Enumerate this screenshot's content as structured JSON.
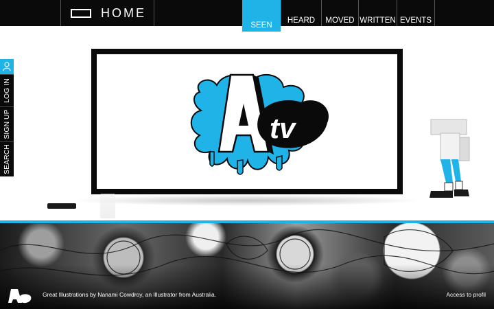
{
  "header": {
    "home_label": "HOME",
    "nav": [
      {
        "label": "SEEN",
        "active": true
      },
      {
        "label": "HEARD",
        "active": false
      },
      {
        "label": "MOVED",
        "active": false
      },
      {
        "label": "WRITTEN",
        "active": false
      },
      {
        "label": "EVENTS",
        "active": false
      }
    ]
  },
  "sidebar": {
    "user_icon": "user-icon",
    "items": [
      {
        "label": "LOG IN"
      },
      {
        "label": "SIGN UP"
      },
      {
        "label": "SEARCH"
      }
    ]
  },
  "screen": {
    "logo_letter": "A",
    "logo_text": "tv"
  },
  "footer": {
    "caption": "Great Illustrations by Nanami Cowdroy, an Illustrator from Australia.",
    "access_link": "Access to profil"
  },
  "colors": {
    "accent": "#1fb3e8",
    "bar": "#0a0a0a"
  }
}
